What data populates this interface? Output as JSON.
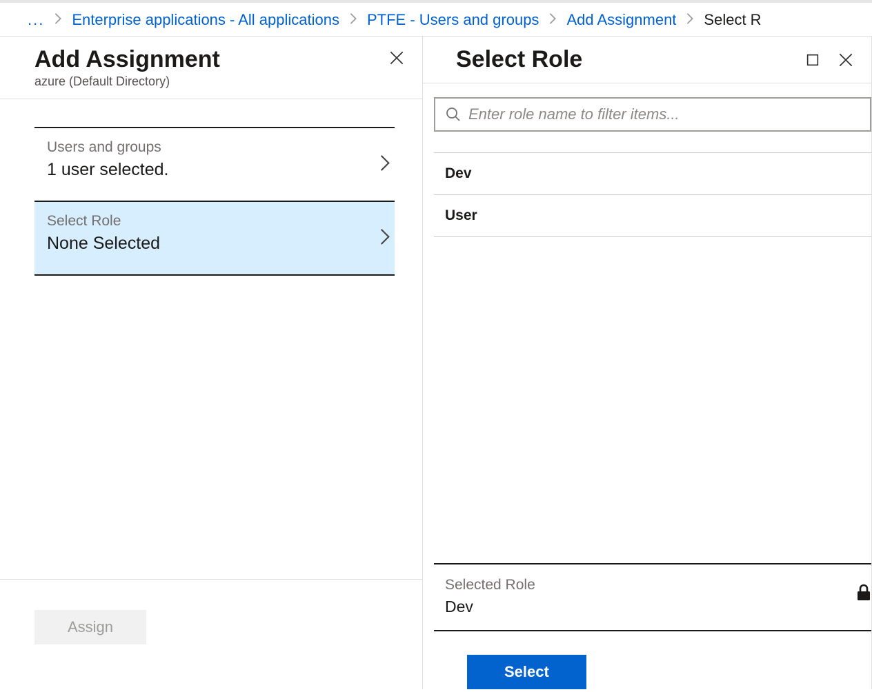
{
  "breadcrumb": {
    "items": [
      {
        "label": "Enterprise applications - All applications",
        "link": true
      },
      {
        "label": "PTFE - Users and groups",
        "link": true
      },
      {
        "label": "Add Assignment",
        "link": true
      },
      {
        "label": "Select R",
        "link": false
      }
    ]
  },
  "left": {
    "title": "Add Assignment",
    "subtitle": "azure (Default Directory)",
    "steps": [
      {
        "label": "Users and groups",
        "value": "1 user selected.",
        "active": false
      },
      {
        "label": "Select Role",
        "value": "None Selected",
        "active": true
      }
    ],
    "assign_label": "Assign"
  },
  "right": {
    "title": "Select Role",
    "filter_placeholder": "Enter role name to filter items...",
    "roles": [
      "Dev",
      "User"
    ],
    "selected_label": "Selected Role",
    "selected_value": "Dev",
    "select_button": "Select"
  }
}
